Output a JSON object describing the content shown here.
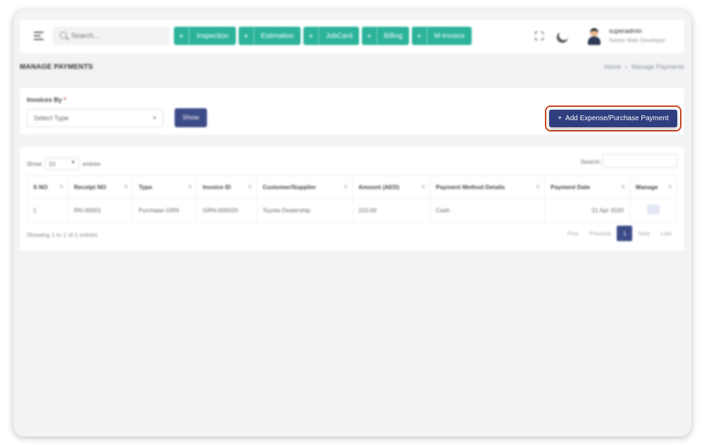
{
  "topbar": {
    "search_placeholder": "Search...",
    "quick_actions": [
      {
        "label": "Inspection"
      },
      {
        "label": "Estimation"
      },
      {
        "label": "JobCard"
      },
      {
        "label": "Billing"
      },
      {
        "label": "M-Invoice"
      }
    ],
    "user": {
      "name": "superadmin",
      "role": "Senior Web Developer"
    },
    "accent_color": "#2bb39a"
  },
  "page": {
    "title": "MANAGE PAYMENTS",
    "breadcrumb": [
      "Home",
      "Manage Payments"
    ]
  },
  "filter": {
    "label": "Invoices By",
    "required_mark": "*",
    "select_value": "Select Type",
    "show_button": "Show",
    "add_button": "Add Expense/Purchase Payment"
  },
  "table": {
    "length_prefix": "Show",
    "length_value": "10",
    "length_suffix": "entries",
    "search_label": "Search:",
    "columns": [
      "S NO",
      "Receipt NO",
      "Type",
      "Invoice ID",
      "Customer/Supplier",
      "Amount (AED)",
      "Payment Method Details",
      "Payment Date",
      "Manage"
    ],
    "rows": [
      [
        "1",
        "RN-00001",
        "Purchase GRN",
        "GRN-000020",
        "Toyota Dealership",
        "210.00",
        "Cash",
        "21 Apr 2020"
      ]
    ],
    "info": "Showing 1 to 1 of 1 entries",
    "pagination": {
      "first": "First",
      "previous": "Previous",
      "current": "1",
      "next": "Next",
      "last": "Last"
    }
  },
  "colors": {
    "primary": "#2f3e7e",
    "highlight_border": "#c8431c"
  }
}
